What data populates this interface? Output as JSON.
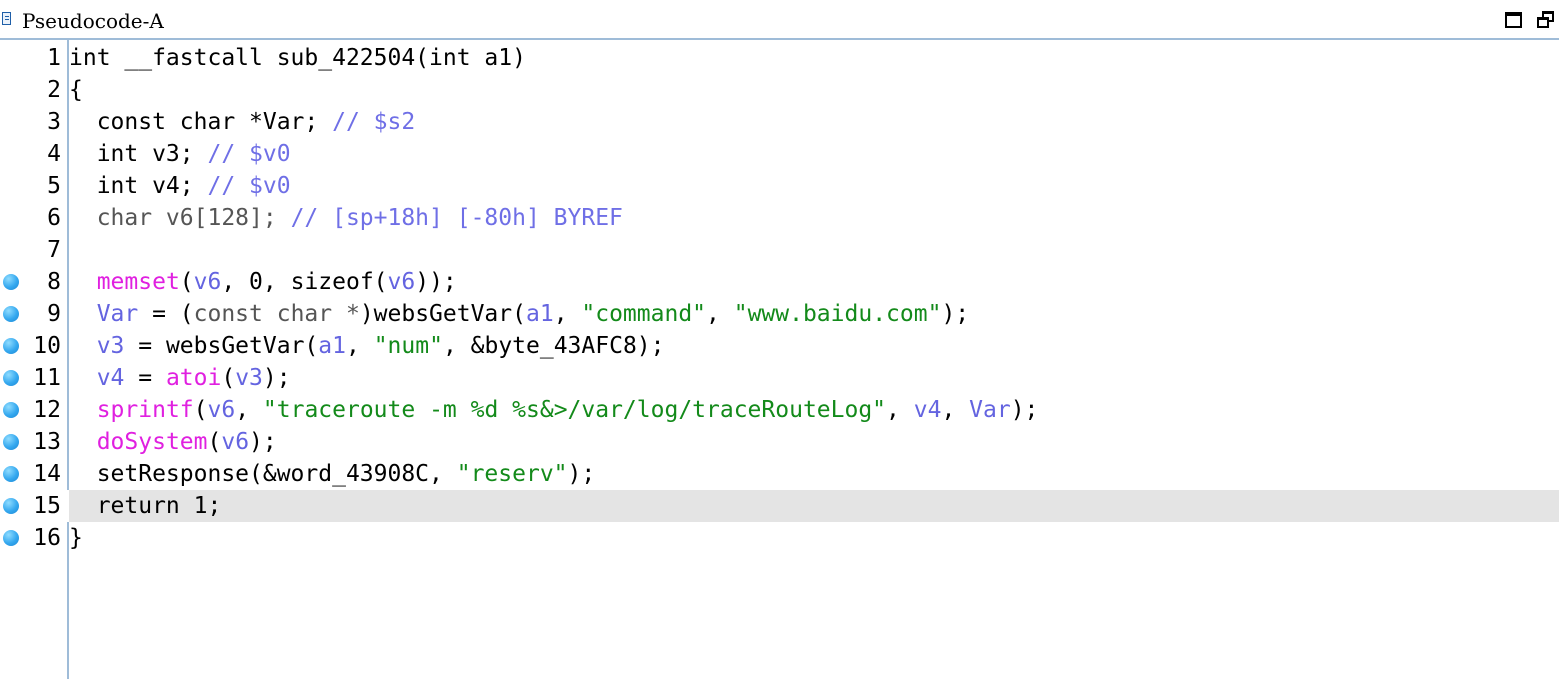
{
  "window": {
    "title": "Pseudocode-A",
    "icons": [
      "pseudocode-window-icon",
      "maximize-icon",
      "restore-icon"
    ]
  },
  "colors": {
    "keyword": "#000000",
    "variable": "#6464e0",
    "comment": "#6f6fe6",
    "function": "#e020e0",
    "string": "#138a1a",
    "current_line_bg": "#e4e4e4",
    "gutter_border": "#9fbcd8",
    "breakpoint": "#34a8ef"
  },
  "editor": {
    "current_line": 15,
    "lines": [
      {
        "num": "1",
        "bp": false,
        "tokens": [
          [
            "k",
            "int __fastcall sub_422504("
          ],
          [
            "k",
            "int a1"
          ],
          [
            "k",
            ")"
          ]
        ]
      },
      {
        "num": "2",
        "bp": false,
        "tokens": [
          [
            "k",
            "{"
          ]
        ]
      },
      {
        "num": "3",
        "bp": false,
        "tokens": [
          [
            "k",
            "  const char *Var; "
          ],
          [
            "c",
            "// $s2"
          ]
        ]
      },
      {
        "num": "4",
        "bp": false,
        "tokens": [
          [
            "k",
            "  int v3; "
          ],
          [
            "c",
            "// $v0"
          ]
        ]
      },
      {
        "num": "5",
        "bp": false,
        "tokens": [
          [
            "k",
            "  int v4; "
          ],
          [
            "c",
            "// $v0"
          ]
        ]
      },
      {
        "num": "6",
        "bp": false,
        "tokens": [
          [
            "d",
            "  char v6[128]; "
          ],
          [
            "c",
            "// [sp+18h] [-80h] BYREF"
          ]
        ]
      },
      {
        "num": "7",
        "bp": false,
        "tokens": []
      },
      {
        "num": "8",
        "bp": true,
        "tokens": [
          [
            "k",
            "  "
          ],
          [
            "f",
            "memset"
          ],
          [
            "k",
            "("
          ],
          [
            "v",
            "v6"
          ],
          [
            "k",
            ", 0, sizeof("
          ],
          [
            "v",
            "v6"
          ],
          [
            "k",
            "));"
          ]
        ]
      },
      {
        "num": "9",
        "bp": true,
        "tokens": [
          [
            "k",
            "  "
          ],
          [
            "v",
            "Var"
          ],
          [
            "k",
            " = ("
          ],
          [
            "d",
            "const char *"
          ],
          [
            "k",
            ")websGetVar("
          ],
          [
            "v",
            "a1"
          ],
          [
            "k",
            ", "
          ],
          [
            "s",
            "\"command\""
          ],
          [
            "k",
            ", "
          ],
          [
            "s",
            "\"www.baidu.com\""
          ],
          [
            "k",
            ");"
          ]
        ]
      },
      {
        "num": "10",
        "bp": true,
        "tokens": [
          [
            "k",
            "  "
          ],
          [
            "v",
            "v3"
          ],
          [
            "k",
            " = websGetVar("
          ],
          [
            "v",
            "a1"
          ],
          [
            "k",
            ", "
          ],
          [
            "s",
            "\"num\""
          ],
          [
            "k",
            ", &byte_43AFC8);"
          ]
        ]
      },
      {
        "num": "11",
        "bp": true,
        "tokens": [
          [
            "k",
            "  "
          ],
          [
            "v",
            "v4"
          ],
          [
            "k",
            " = "
          ],
          [
            "f",
            "atoi"
          ],
          [
            "k",
            "("
          ],
          [
            "v",
            "v3"
          ],
          [
            "k",
            ");"
          ]
        ]
      },
      {
        "num": "12",
        "bp": true,
        "tokens": [
          [
            "k",
            "  "
          ],
          [
            "f",
            "sprintf"
          ],
          [
            "k",
            "("
          ],
          [
            "v",
            "v6"
          ],
          [
            "k",
            ", "
          ],
          [
            "s",
            "\"traceroute -m %d %s&>/var/log/traceRouteLog\""
          ],
          [
            "k",
            ", "
          ],
          [
            "v",
            "v4"
          ],
          [
            "k",
            ", "
          ],
          [
            "v",
            "Var"
          ],
          [
            "k",
            ");"
          ]
        ]
      },
      {
        "num": "13",
        "bp": true,
        "tokens": [
          [
            "k",
            "  "
          ],
          [
            "f",
            "doSystem"
          ],
          [
            "k",
            "("
          ],
          [
            "v",
            "v6"
          ],
          [
            "k",
            ");"
          ]
        ]
      },
      {
        "num": "14",
        "bp": true,
        "tokens": [
          [
            "k",
            "  setResponse(&word_43908C, "
          ],
          [
            "s",
            "\"reserv\""
          ],
          [
            "k",
            ");"
          ]
        ]
      },
      {
        "num": "15",
        "bp": true,
        "tokens": [
          [
            "k",
            "  return 1;"
          ]
        ]
      },
      {
        "num": "16",
        "bp": true,
        "tokens": [
          [
            "k",
            "}"
          ]
        ]
      }
    ]
  }
}
